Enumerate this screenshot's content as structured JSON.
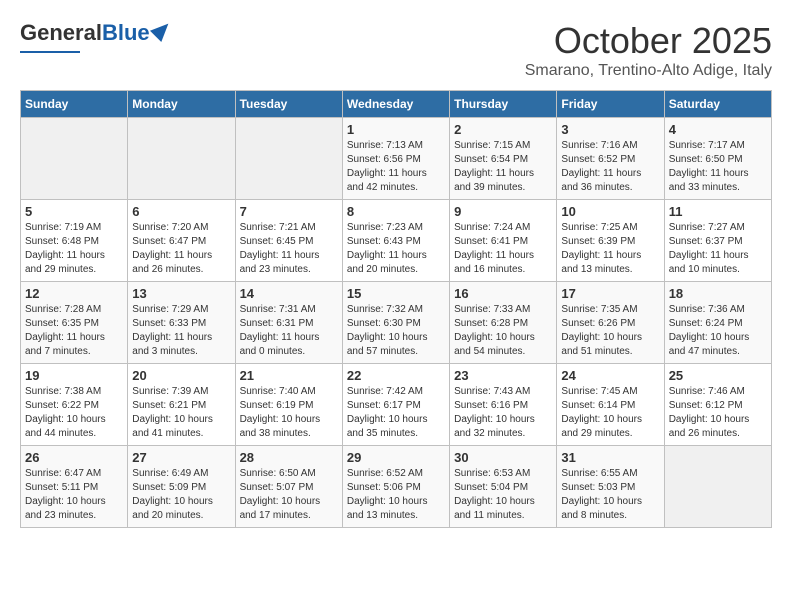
{
  "header": {
    "logo_general": "General",
    "logo_blue": "Blue",
    "month_title": "October 2025",
    "location": "Smarano, Trentino-Alto Adige, Italy"
  },
  "days_of_week": [
    "Sunday",
    "Monday",
    "Tuesday",
    "Wednesday",
    "Thursday",
    "Friday",
    "Saturday"
  ],
  "weeks": [
    [
      {
        "day": "",
        "info": ""
      },
      {
        "day": "",
        "info": ""
      },
      {
        "day": "",
        "info": ""
      },
      {
        "day": "1",
        "info": "Sunrise: 7:13 AM\nSunset: 6:56 PM\nDaylight: 11 hours and 42 minutes."
      },
      {
        "day": "2",
        "info": "Sunrise: 7:15 AM\nSunset: 6:54 PM\nDaylight: 11 hours and 39 minutes."
      },
      {
        "day": "3",
        "info": "Sunrise: 7:16 AM\nSunset: 6:52 PM\nDaylight: 11 hours and 36 minutes."
      },
      {
        "day": "4",
        "info": "Sunrise: 7:17 AM\nSunset: 6:50 PM\nDaylight: 11 hours and 33 minutes."
      }
    ],
    [
      {
        "day": "5",
        "info": "Sunrise: 7:19 AM\nSunset: 6:48 PM\nDaylight: 11 hours and 29 minutes."
      },
      {
        "day": "6",
        "info": "Sunrise: 7:20 AM\nSunset: 6:47 PM\nDaylight: 11 hours and 26 minutes."
      },
      {
        "day": "7",
        "info": "Sunrise: 7:21 AM\nSunset: 6:45 PM\nDaylight: 11 hours and 23 minutes."
      },
      {
        "day": "8",
        "info": "Sunrise: 7:23 AM\nSunset: 6:43 PM\nDaylight: 11 hours and 20 minutes."
      },
      {
        "day": "9",
        "info": "Sunrise: 7:24 AM\nSunset: 6:41 PM\nDaylight: 11 hours and 16 minutes."
      },
      {
        "day": "10",
        "info": "Sunrise: 7:25 AM\nSunset: 6:39 PM\nDaylight: 11 hours and 13 minutes."
      },
      {
        "day": "11",
        "info": "Sunrise: 7:27 AM\nSunset: 6:37 PM\nDaylight: 11 hours and 10 minutes."
      }
    ],
    [
      {
        "day": "12",
        "info": "Sunrise: 7:28 AM\nSunset: 6:35 PM\nDaylight: 11 hours and 7 minutes."
      },
      {
        "day": "13",
        "info": "Sunrise: 7:29 AM\nSunset: 6:33 PM\nDaylight: 11 hours and 3 minutes."
      },
      {
        "day": "14",
        "info": "Sunrise: 7:31 AM\nSunset: 6:31 PM\nDaylight: 11 hours and 0 minutes."
      },
      {
        "day": "15",
        "info": "Sunrise: 7:32 AM\nSunset: 6:30 PM\nDaylight: 10 hours and 57 minutes."
      },
      {
        "day": "16",
        "info": "Sunrise: 7:33 AM\nSunset: 6:28 PM\nDaylight: 10 hours and 54 minutes."
      },
      {
        "day": "17",
        "info": "Sunrise: 7:35 AM\nSunset: 6:26 PM\nDaylight: 10 hours and 51 minutes."
      },
      {
        "day": "18",
        "info": "Sunrise: 7:36 AM\nSunset: 6:24 PM\nDaylight: 10 hours and 47 minutes."
      }
    ],
    [
      {
        "day": "19",
        "info": "Sunrise: 7:38 AM\nSunset: 6:22 PM\nDaylight: 10 hours and 44 minutes."
      },
      {
        "day": "20",
        "info": "Sunrise: 7:39 AM\nSunset: 6:21 PM\nDaylight: 10 hours and 41 minutes."
      },
      {
        "day": "21",
        "info": "Sunrise: 7:40 AM\nSunset: 6:19 PM\nDaylight: 10 hours and 38 minutes."
      },
      {
        "day": "22",
        "info": "Sunrise: 7:42 AM\nSunset: 6:17 PM\nDaylight: 10 hours and 35 minutes."
      },
      {
        "day": "23",
        "info": "Sunrise: 7:43 AM\nSunset: 6:16 PM\nDaylight: 10 hours and 32 minutes."
      },
      {
        "day": "24",
        "info": "Sunrise: 7:45 AM\nSunset: 6:14 PM\nDaylight: 10 hours and 29 minutes."
      },
      {
        "day": "25",
        "info": "Sunrise: 7:46 AM\nSunset: 6:12 PM\nDaylight: 10 hours and 26 minutes."
      }
    ],
    [
      {
        "day": "26",
        "info": "Sunrise: 6:47 AM\nSunset: 5:11 PM\nDaylight: 10 hours and 23 minutes."
      },
      {
        "day": "27",
        "info": "Sunrise: 6:49 AM\nSunset: 5:09 PM\nDaylight: 10 hours and 20 minutes."
      },
      {
        "day": "28",
        "info": "Sunrise: 6:50 AM\nSunset: 5:07 PM\nDaylight: 10 hours and 17 minutes."
      },
      {
        "day": "29",
        "info": "Sunrise: 6:52 AM\nSunset: 5:06 PM\nDaylight: 10 hours and 13 minutes."
      },
      {
        "day": "30",
        "info": "Sunrise: 6:53 AM\nSunset: 5:04 PM\nDaylight: 10 hours and 11 minutes."
      },
      {
        "day": "31",
        "info": "Sunrise: 6:55 AM\nSunset: 5:03 PM\nDaylight: 10 hours and 8 minutes."
      },
      {
        "day": "",
        "info": ""
      }
    ]
  ]
}
